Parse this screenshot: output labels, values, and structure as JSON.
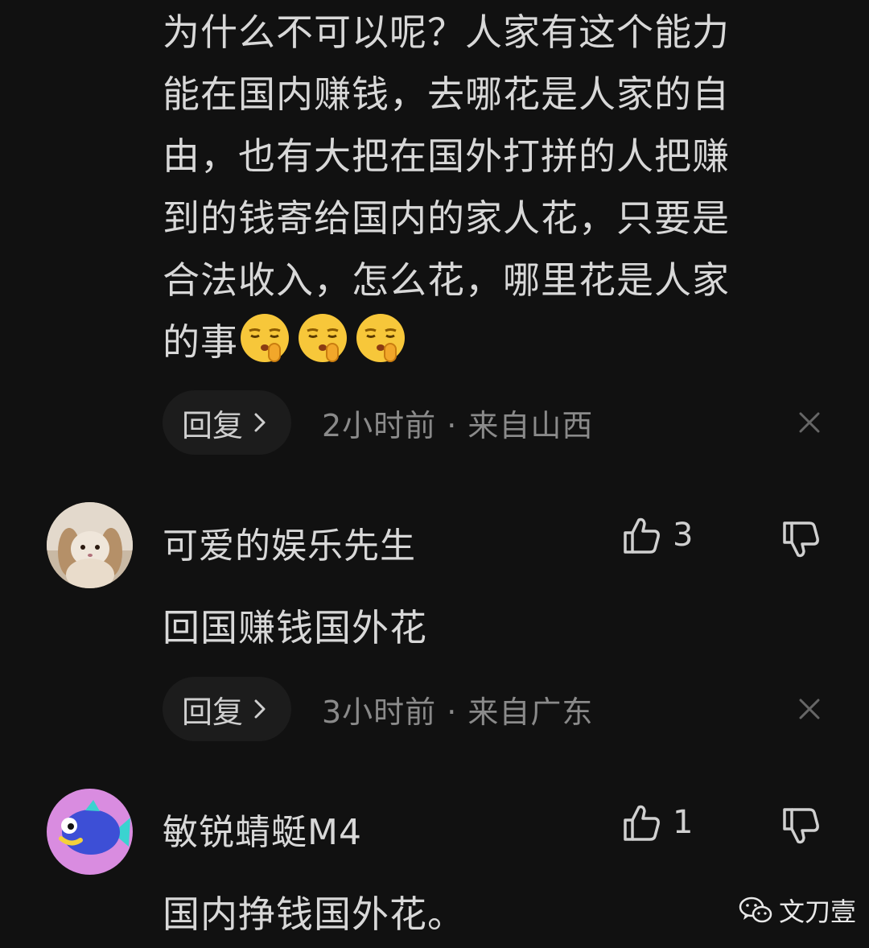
{
  "comment_top": {
    "lines": [
      "为什么不可以呢？人家有这个能力",
      "能在国内赚钱，去哪花是人家的自",
      "由，也有大把在国外打拼的人把赚",
      "到的钱寄给国内的家人花，只要是",
      "合法收入，怎么花，哪里花是人家"
    ],
    "last_line_text": "的事",
    "emoji": "shushing-face-icon",
    "reply_label": "回复",
    "meta": "2小时前 · 来自山西"
  },
  "comment_2": {
    "username": "可爱的娱乐先生",
    "likes": "3",
    "text": "回国赚钱国外花",
    "reply_label": "回复",
    "meta": "3小时前 · 来自广东"
  },
  "comment_3": {
    "username": "敏锐蜻蜓M4",
    "likes": "1",
    "text": "国内挣钱国外花。"
  },
  "watermark": {
    "label": "文刀壹"
  },
  "colors": {
    "background": "#111111",
    "text": "#d8d8d8",
    "muted": "#8a8a8a",
    "reply_bg": "#1c1c1c"
  }
}
